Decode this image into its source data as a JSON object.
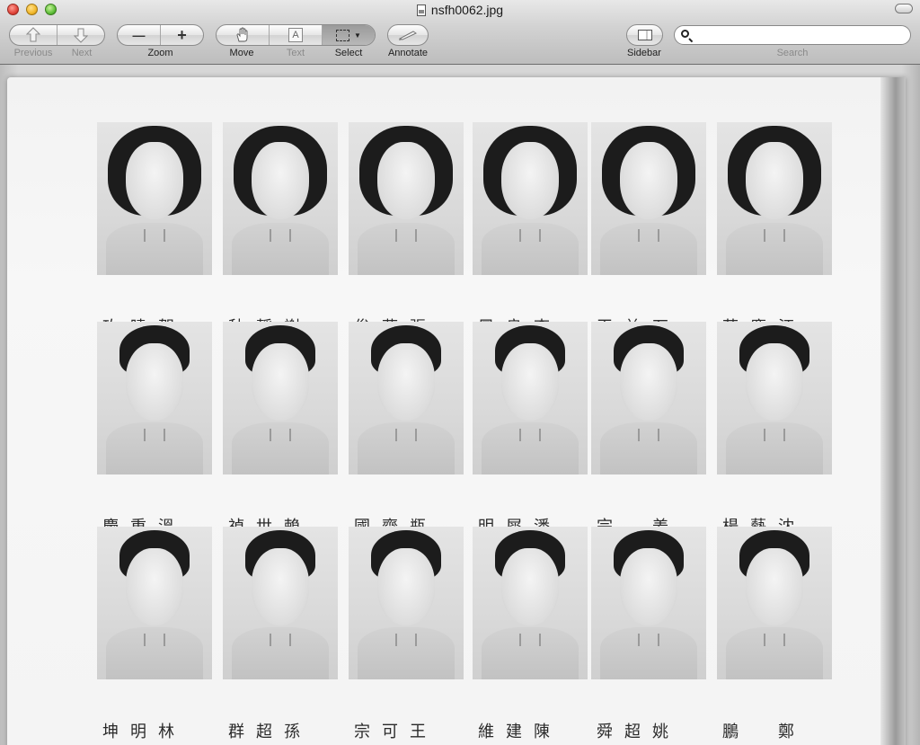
{
  "window": {
    "title": "nsfh0062.jpg"
  },
  "toolbar": {
    "previous_label": "Previous",
    "next_label": "Next",
    "zoom_label": "Zoom",
    "zoom_out_glyph": "—",
    "zoom_in_glyph": "+",
    "move_label": "Move",
    "text_label": "Text",
    "text_glyph": "A",
    "select_label": "Select",
    "annotate_label": "Annotate",
    "sidebar_label": "Sidebar",
    "search_label": "Search",
    "search_value": ""
  },
  "photos": {
    "rows": [
      {
        "students": [
          {
            "name": "玫曉賀",
            "hair": "long"
          },
          {
            "name": "秋靜謝",
            "hair": "long"
          },
          {
            "name": "俊燕張",
            "hair": "long"
          },
          {
            "name": "鳳良李",
            "hair": "long"
          },
          {
            "name": "玉益石",
            "hair": "long"
          },
          {
            "name": "蘇慶汪",
            "hair": "long"
          }
        ]
      },
      {
        "students": [
          {
            "name": "慶重溫",
            "hair": "short"
          },
          {
            "name": "禎世賴",
            "hair": "short"
          },
          {
            "name": "國齊瓶",
            "hair": "short"
          },
          {
            "name": "明犀潘",
            "hair": "short"
          },
          {
            "name": "宗　姜",
            "hair": "short"
          },
          {
            "name": "楊藝沈",
            "hair": "short"
          }
        ]
      },
      {
        "students": [
          {
            "name": "坤明林",
            "hair": "short"
          },
          {
            "name": "群超孫",
            "hair": "short"
          },
          {
            "name": "宗可王",
            "hair": "short"
          },
          {
            "name": "維建陳",
            "hair": "short"
          },
          {
            "name": "舜超姚",
            "hair": "short"
          },
          {
            "name": "鵬　鄭",
            "hair": "short"
          }
        ]
      }
    ]
  }
}
